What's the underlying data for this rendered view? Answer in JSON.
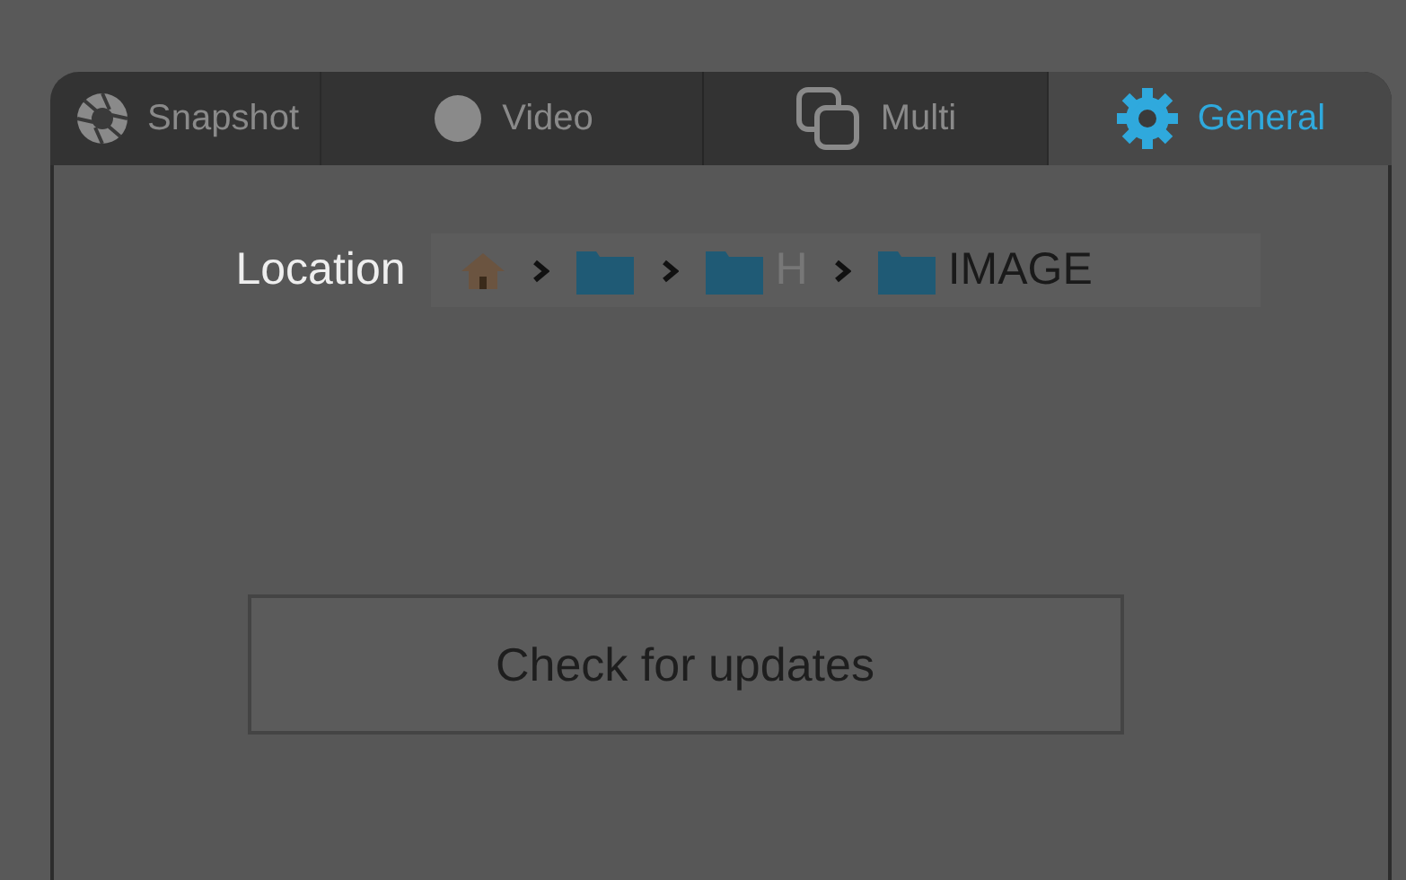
{
  "tabs": [
    {
      "label": "Snapshot",
      "kind": "snapshot",
      "selected": false
    },
    {
      "label": "Video",
      "kind": "video",
      "selected": false
    },
    {
      "label": "Multi",
      "kind": "multi",
      "selected": false
    },
    {
      "label": "General",
      "kind": "general",
      "selected": true
    }
  ],
  "location": {
    "label": "Location",
    "path": [
      {
        "kind": "home"
      },
      {
        "kind": "folder"
      },
      {
        "kind": "folder",
        "name": "H"
      },
      {
        "kind": "folder",
        "name": "IMAGE"
      }
    ]
  },
  "buttons": [
    {
      "label": "Check for updates"
    }
  ]
}
